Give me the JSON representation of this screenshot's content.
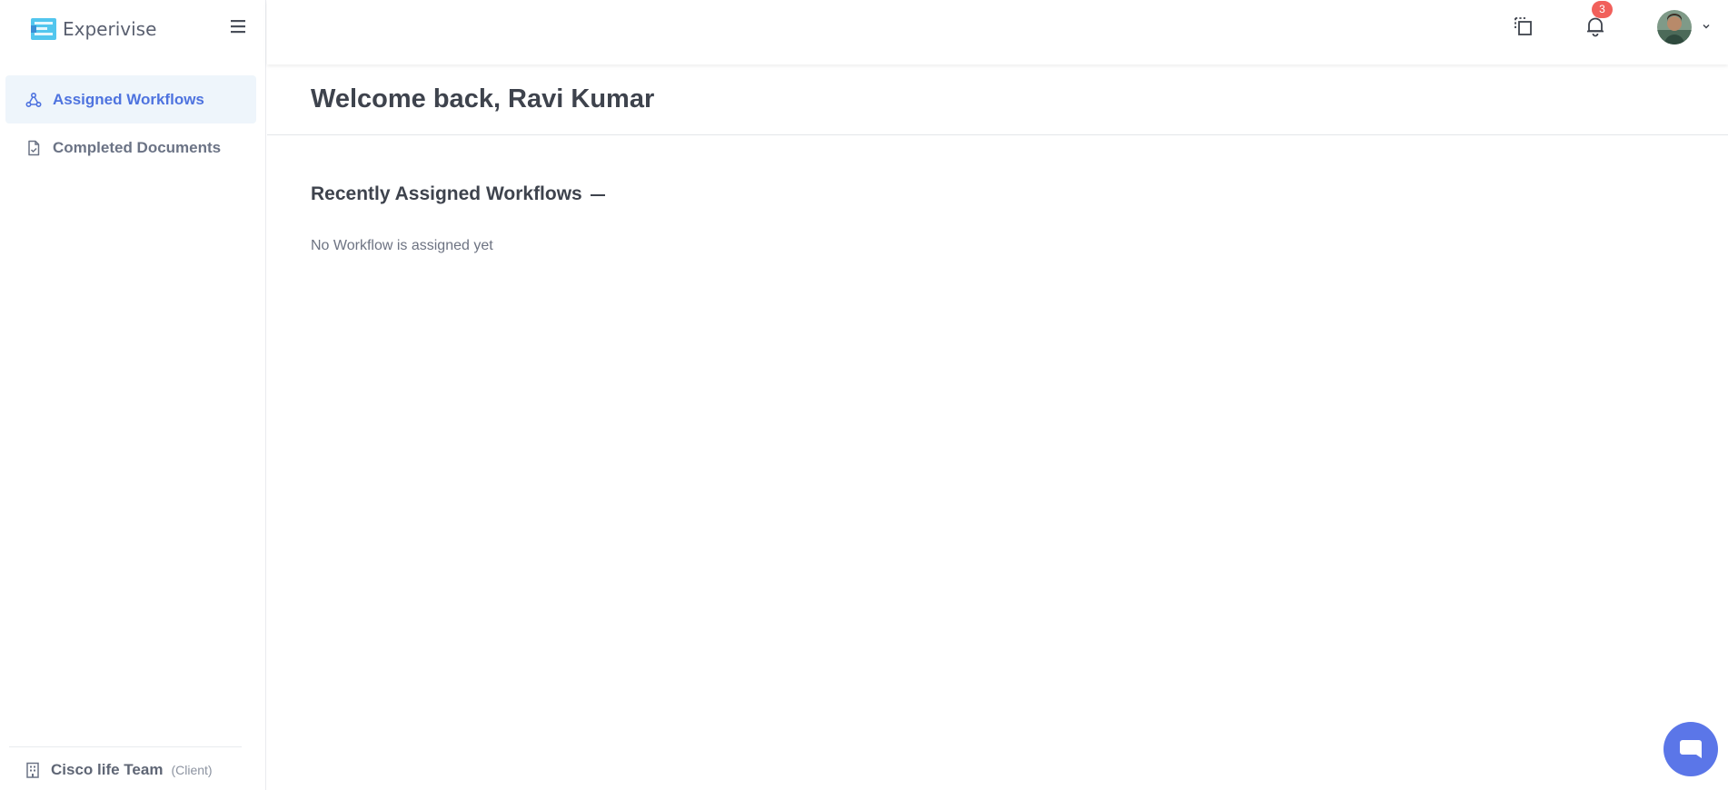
{
  "brand": {
    "name": "Experivise",
    "logo_icon": "stacked-bars-logo-icon"
  },
  "header": {
    "icons": [
      "copy-document-icon",
      "bell-icon",
      "user-avatar",
      "chevron-down-icon"
    ],
    "notifications_count": "3",
    "badge_color": "#f1605b"
  },
  "sidebar": {
    "items": [
      {
        "label": "Assigned Workflows",
        "icon": "workflow-nodes-icon",
        "active": true
      },
      {
        "label": "Completed Documents",
        "icon": "document-check-icon",
        "active": false
      }
    ],
    "org": {
      "name": "Cisco life Team",
      "role": "(Client)",
      "icon": "building-icon"
    }
  },
  "main": {
    "welcome_title": "Welcome back, Ravi Kumar",
    "section_title": "Recently Assigned Workflows",
    "empty_message": "No Workflow is assigned yet"
  },
  "colors": {
    "accent": "#4e73df",
    "active_bg": "#eef5fb",
    "chat_button": "#5b76e8"
  }
}
